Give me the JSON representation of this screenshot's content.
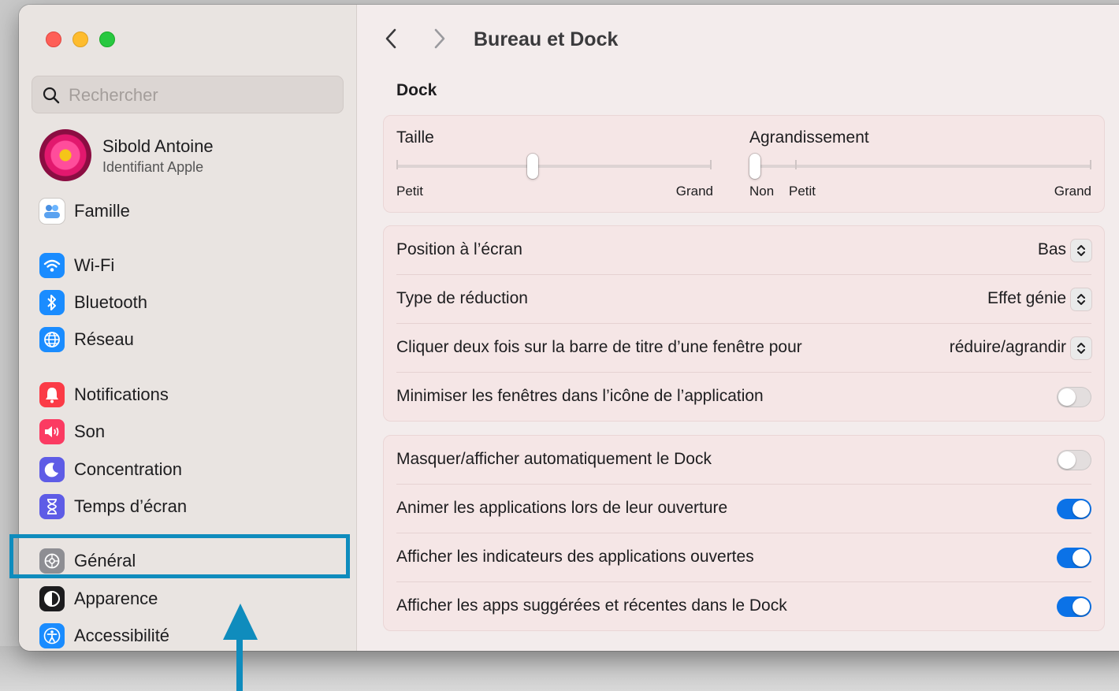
{
  "sidebar": {
    "search_placeholder": "Rechercher",
    "profile": {
      "name": "Sibold Antoine",
      "subtitle": "Identifiant Apple"
    },
    "items": [
      {
        "label": "Famille",
        "icon": "family-icon",
        "color": "#ffffff"
      },
      {
        "label": "Wi-Fi",
        "icon": "wifi-icon",
        "color": "#1a8cff"
      },
      {
        "label": "Bluetooth",
        "icon": "bluetooth-icon",
        "color": "#1a8cff"
      },
      {
        "label": "Réseau",
        "icon": "globe-icon",
        "color": "#1a8cff"
      },
      {
        "label": "Notifications",
        "icon": "bell-icon",
        "color": "#fb3b46"
      },
      {
        "label": "Son",
        "icon": "speaker-icon",
        "color": "#fb3b62"
      },
      {
        "label": "Concentration",
        "icon": "moon-icon",
        "color": "#5e5ce6"
      },
      {
        "label": "Temps d’écran",
        "icon": "hourglass-icon",
        "color": "#5e5ce6"
      },
      {
        "label": "Général",
        "icon": "gear-icon",
        "color": "#8e8e93"
      },
      {
        "label": "Apparence",
        "icon": "appearance-icon",
        "color": "#1c1c1e"
      },
      {
        "label": "Accessibilité",
        "icon": "accessibility-icon",
        "color": "#1a8cff"
      }
    ]
  },
  "header": {
    "title": "Bureau et Dock"
  },
  "dock": {
    "section_title": "Dock",
    "size": {
      "label": "Taille",
      "min_label": "Petit",
      "max_label": "Grand",
      "value": 0.43
    },
    "magnification": {
      "label": "Agrandissement",
      "off_label": "Non",
      "min_label": "Petit",
      "max_label": "Grand",
      "value": 0
    },
    "settings": [
      {
        "label": "Position à l’écran",
        "value": "Bas"
      },
      {
        "label": "Type de réduction",
        "value": "Effet génie"
      },
      {
        "label": "Cliquer deux fois sur la barre de titre d’une fenêtre pour",
        "value": "réduire/agrandir"
      },
      {
        "label": "Minimiser les fenêtres dans l’icône de l’application",
        "toggle": false
      }
    ],
    "toggles": [
      {
        "label": "Masquer/afficher automatiquement le Dock",
        "on": false
      },
      {
        "label": "Animer les applications lors de leur ouverture",
        "on": true
      },
      {
        "label": "Afficher les indicateurs des applications ouvertes",
        "on": true
      },
      {
        "label": "Afficher les apps suggérées et récentes dans le Dock",
        "on": true
      }
    ]
  },
  "annotation": {
    "highlight_color": "#0f8cbd"
  }
}
